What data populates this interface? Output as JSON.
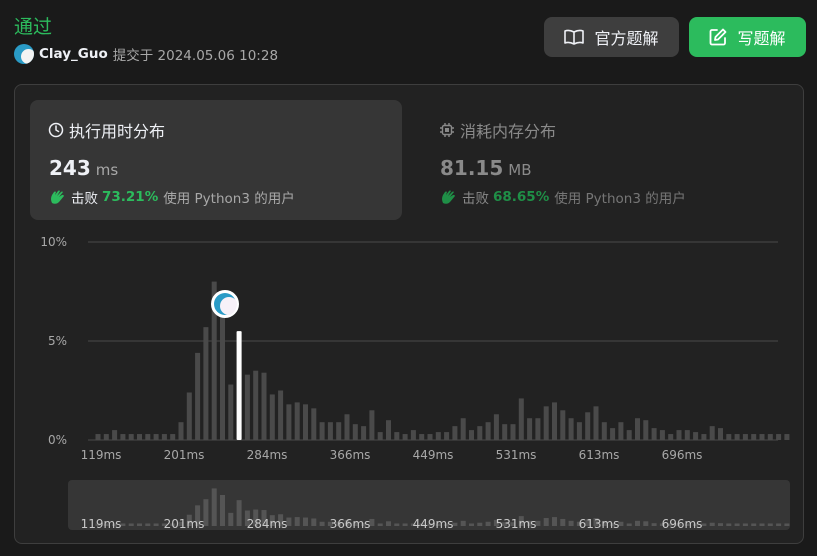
{
  "header": {
    "status": "通过",
    "username": "Clay_Guo",
    "submitted_text": "提交于 2024.05.06 10:28",
    "official_solution_label": "官方题解",
    "write_solution_label": "写题解"
  },
  "cards": {
    "runtime": {
      "title": "执行用时分布",
      "value": "243",
      "unit": "ms",
      "beat_label": "击败",
      "beat_pct": "73.21%",
      "beat_suffix": "使用 Python3 的用户"
    },
    "memory": {
      "title": "消耗内存分布",
      "value": "81.15",
      "unit": "MB",
      "beat_label": "击败",
      "beat_pct": "68.65%",
      "beat_suffix": "使用 Python3 的用户"
    }
  },
  "colors": {
    "accent_green": "#2cbb5d",
    "bar": "#4a4a4a",
    "highlight_bar": "#ffffff"
  },
  "chart_data": {
    "type": "bar",
    "title": "",
    "xlabel": "",
    "ylabel": "",
    "y_tick_labels": [
      "10%",
      "5%",
      "0%"
    ],
    "ylim": [
      0,
      10
    ],
    "x_tick_labels": [
      "119ms",
      "201ms",
      "284ms",
      "366ms",
      "449ms",
      "531ms",
      "613ms",
      "696ms"
    ],
    "x_tick_indices": [
      0,
      10,
      20,
      30,
      40,
      50,
      60,
      70
    ],
    "highlight_index": 17,
    "highlight_value": 5.5,
    "values": [
      0.3,
      0.3,
      0.5,
      0.3,
      0.3,
      0.3,
      0.3,
      0.3,
      0.3,
      0.3,
      0.9,
      2.4,
      4.4,
      5.7,
      8.0,
      6.6,
      2.8,
      5.5,
      3.3,
      3.5,
      3.4,
      2.3,
      2.5,
      1.8,
      1.9,
      1.8,
      1.6,
      0.9,
      0.9,
      0.9,
      1.3,
      0.8,
      0.7,
      1.5,
      0.4,
      1.0,
      0.4,
      0.3,
      0.5,
      0.3,
      0.3,
      0.4,
      0.4,
      0.7,
      1.1,
      0.5,
      0.7,
      0.9,
      1.3,
      0.8,
      0.8,
      2.1,
      1.1,
      1.1,
      1.7,
      1.9,
      1.5,
      1.1,
      0.9,
      1.4,
      1.7,
      0.9,
      0.6,
      0.9,
      0.5,
      1.1,
      1.0,
      0.6,
      0.5,
      0.3,
      0.5,
      0.5,
      0.4,
      0.3,
      0.7,
      0.6,
      0.3,
      0.3,
      0.3,
      0.3,
      0.3,
      0.3,
      0.3,
      0.3
    ]
  }
}
